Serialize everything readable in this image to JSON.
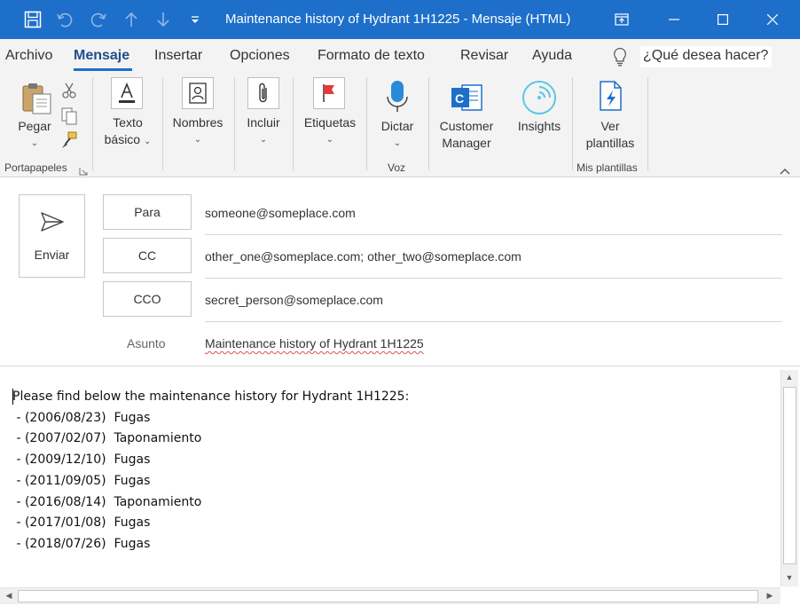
{
  "window": {
    "title": "Maintenance history of Hydrant 1H1225  -  Mensaje (HTML)",
    "accent_color": "#1e6fc9",
    "icons": [
      "save-icon",
      "undo-icon",
      "redo-icon",
      "up-arrow-icon",
      "down-arrow-icon",
      "customize-icon",
      "restore-ribbon-icon",
      "minimize-icon",
      "maximize-icon",
      "close-icon"
    ]
  },
  "menu": {
    "tabs": [
      {
        "label": "Archivo"
      },
      {
        "label": "Mensaje"
      },
      {
        "label": "Insertar"
      },
      {
        "label": "Opciones"
      },
      {
        "label": "Formato de texto"
      },
      {
        "label": "Revisar"
      },
      {
        "label": "Ayuda"
      }
    ],
    "active_tab": "Mensaje",
    "search_placeholder": "¿Qué desea hacer?"
  },
  "ribbon": {
    "pegar": "Pegar",
    "texto": "Texto",
    "basico": "básico",
    "nombres": "Nombres",
    "incluir": "Incluir",
    "etiquetas": "Etiquetas",
    "dictar": "Dictar",
    "customer": "Customer",
    "manager": "Manager",
    "insights": "Insights",
    "ver": "Ver",
    "plantillas": "plantillas",
    "groups": {
      "portapapeles": "Portapapeles",
      "voz": "Voz",
      "mis_plantillas": "Mis plantillas"
    }
  },
  "compose": {
    "send_label": "Enviar",
    "to_label": "Para",
    "to_value": "someone@someplace.com",
    "cc_label": "CC",
    "cc_value": "other_one@someplace.com; other_two@someplace.com",
    "bcc_label": "CCO",
    "bcc_value": "secret_person@someplace.com",
    "subject_label": "Asunto",
    "subject_value": "Maintenance history of Hydrant 1H1225"
  },
  "body": {
    "intro": "Please find below the maintenance history for Hydrant 1H1225:",
    "lines": [
      " - (2006/08/23)  Fugas",
      " - (2007/02/07)  Taponamiento",
      " - (2009/12/10)  Fugas",
      " - (2011/09/05)  Fugas",
      " - (2016/08/14)  Taponamiento",
      " - (2017/01/08)  Fugas",
      " - (2018/07/26)  Fugas"
    ]
  }
}
